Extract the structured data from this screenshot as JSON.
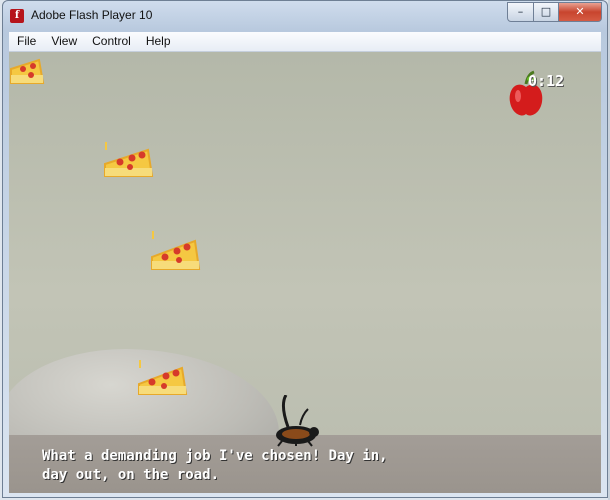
{
  "window": {
    "title": "Adobe Flash Player 10",
    "app_icon_glyph": "f",
    "controls": {
      "minimize": "–",
      "maximize": "□",
      "close": "✕"
    }
  },
  "menu": [
    {
      "label": "File"
    },
    {
      "label": "View"
    },
    {
      "label": "Control"
    },
    {
      "label": "Help"
    }
  ],
  "game": {
    "timer": "0:12",
    "dialog": "What a demanding job I've chosen! Day in,\nday out, on the road.",
    "icons": {
      "collectible": "pizza-slice-icon",
      "bonus": "apple-icon",
      "player": "cockroach-icon"
    },
    "colors": {
      "sky": "#c0c2b4",
      "ground": "#9f9992",
      "pizza_crust": "#f7d24a",
      "pepperoni": "#d63a2a",
      "apple": "#d41c1c"
    }
  }
}
